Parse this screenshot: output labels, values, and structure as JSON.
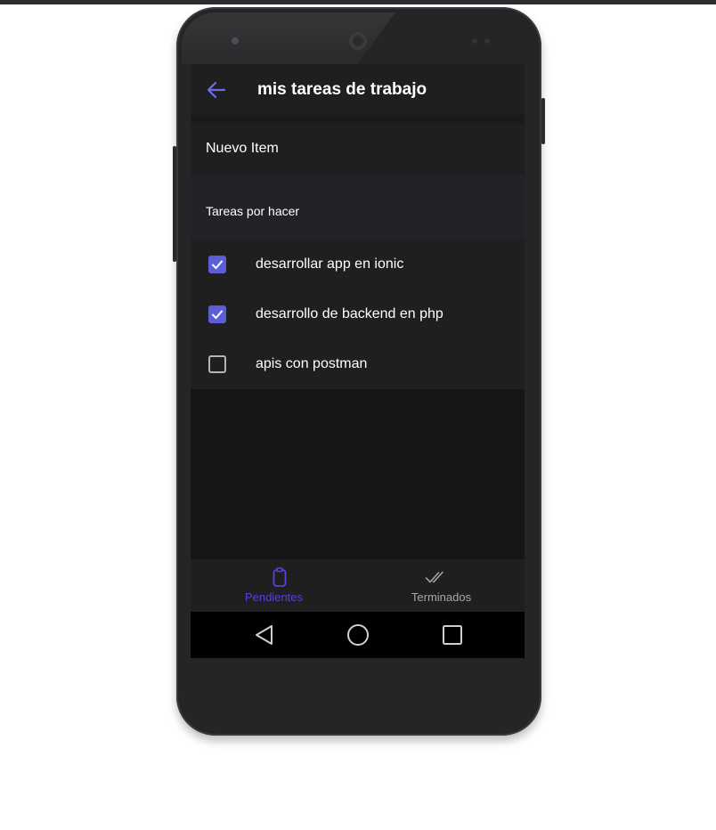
{
  "app": {
    "title": "mis tareas de trabajo"
  },
  "new_item": {
    "label": "Nuevo Item"
  },
  "list": {
    "header": "Tareas por hacer",
    "items": [
      {
        "label": "desarrollar app en ionic",
        "checked": true
      },
      {
        "label": "desarrollo de backend en php",
        "checked": true
      },
      {
        "label": "apis con postman",
        "checked": false
      }
    ]
  },
  "tabs": [
    {
      "label": "Pendientes",
      "icon": "clipboard-icon",
      "active": true
    },
    {
      "label": "Terminados",
      "icon": "done-all-icon",
      "active": false
    }
  ],
  "colors": {
    "accent": "#5c5ed6",
    "active_tab": "#5b3fe0",
    "background": "#161616",
    "surface": "#1f1f1f"
  }
}
